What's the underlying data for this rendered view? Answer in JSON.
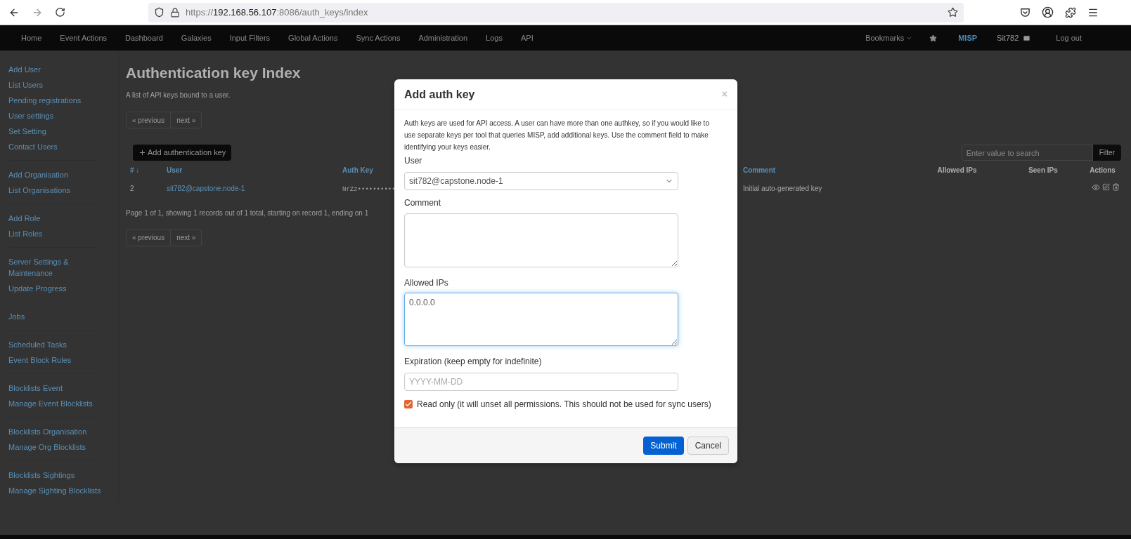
{
  "browser": {
    "url": {
      "scheme": "https://",
      "host": "192.168.56.107",
      "path": ":8086/auth_keys/index"
    }
  },
  "navbar": {
    "items": [
      "Home",
      "Event Actions",
      "Dashboard",
      "Galaxies",
      "Input Filters",
      "Global Actions",
      "Sync Actions",
      "Administration",
      "Logs",
      "API"
    ],
    "bookmarks": "Bookmarks",
    "brand": "MISP",
    "user": "Sit782",
    "logout": "Log out"
  },
  "sidebar": {
    "groups": [
      {
        "items": [
          "Add User",
          "List Users",
          "Pending registrations",
          "User settings",
          "Set Setting",
          "Contact Users"
        ]
      },
      {
        "items": [
          "Add Organisation",
          "List Organisations"
        ]
      },
      {
        "items": [
          "Add Role",
          "List Roles"
        ]
      },
      {
        "items": [
          "Server Settings & Maintenance",
          "Update Progress"
        ]
      },
      {
        "items": [
          "Jobs"
        ]
      },
      {
        "items": [
          "Scheduled Tasks",
          "Event Block Rules"
        ]
      },
      {
        "items": [
          "Blocklists Event",
          "Manage Event Blocklists"
        ]
      },
      {
        "items": [
          "Blocklists Organisation",
          "Manage Org Blocklists"
        ]
      },
      {
        "items": [
          "Blocklists Sightings",
          "Manage Sighting Blocklists"
        ]
      }
    ]
  },
  "page": {
    "title": "Authentication key Index",
    "subtitle": "A list of API keys bound to a user.",
    "pager_top": {
      "previous": "« previous",
      "next": "next »"
    },
    "add_button": "Add authentication key",
    "search": {
      "placeholder": "Enter value to search",
      "button": "Filter"
    },
    "table": {
      "columns": [
        {
          "label": "# ↓",
          "sortable": true
        },
        {
          "label": "User",
          "sortable": true
        },
        {
          "label": "Auth Key",
          "sortable": true
        },
        {
          "label": "Comment",
          "sortable": true
        },
        {
          "label": "Allowed IPs",
          "sortable": false
        },
        {
          "label": "Seen IPs",
          "sortable": false
        },
        {
          "label": "Actions",
          "sortable": false
        }
      ],
      "rows": [
        {
          "id": "2",
          "user": "sit782@capstone.node-1",
          "auth_key": "NrZz••••••••••",
          "comment": "Initial auto-generated key"
        }
      ]
    },
    "summary": "Page 1 of 1, showing 1 records out of 1 total, starting on record 1, ending on 1",
    "pager_bottom": {
      "previous": "« previous",
      "next": "next »"
    }
  },
  "modal": {
    "title": "Add auth key",
    "close": "×",
    "intro": "Auth keys are used for API access. A user can have more than one authkey, so if you would like to use separate keys per tool that queries MISP, add additional keys. Use the comment field to make identifying your keys easier.",
    "user": {
      "label": "User",
      "value": "sit782@capstone.node-1"
    },
    "comment": {
      "label": "Comment",
      "focused": false
    },
    "allowed_ips": {
      "label": "Allowed IPs",
      "value": "0.0.0.0",
      "focused": true
    },
    "expiration": {
      "label": "Expiration (keep empty for indefinite)",
      "placeholder": "YYYY-MM-DD"
    },
    "read_only": {
      "label": "Read only (it will unset all permissions. This should not be used for sync users)",
      "checked": true
    },
    "buttons": {
      "submit": "Submit",
      "cancel": "Cancel"
    }
  }
}
